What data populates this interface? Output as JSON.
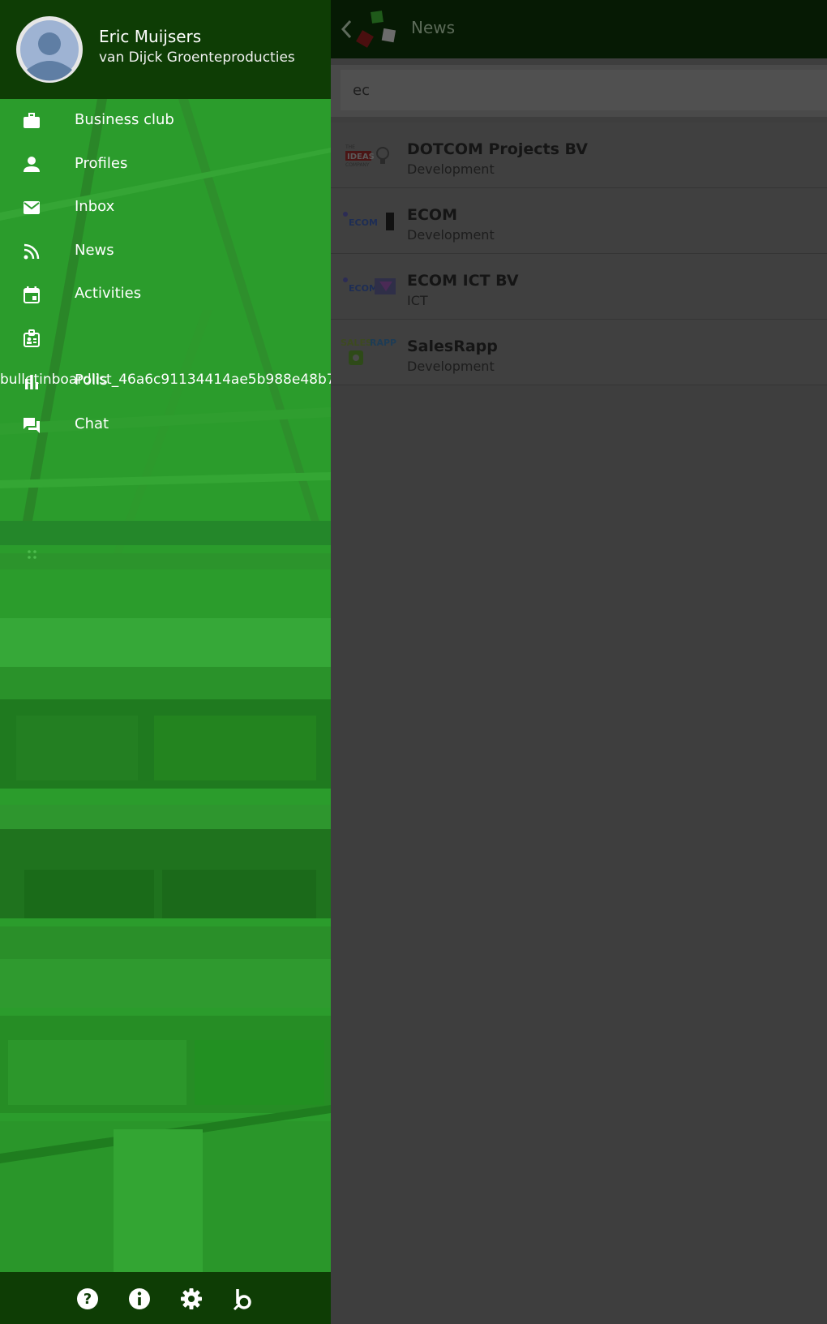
{
  "app": {
    "title": "News",
    "search": {
      "value": "ec"
    },
    "results": [
      {
        "title": "DOTCOM Projects BV",
        "category": "Development",
        "logo": "ideas-company-logo"
      },
      {
        "title": "ECOM",
        "category": "Development",
        "logo": "ecom-logo"
      },
      {
        "title": "ECOM ICT BV",
        "category": "ICT",
        "logo": "ecom-ict-logo"
      },
      {
        "title": "SalesRapp",
        "category": "Development",
        "logo": "salesrapp-logo"
      }
    ]
  },
  "drawer": {
    "user": {
      "name": "Eric Muijsers",
      "company": "van Dijck Groenteproducties"
    },
    "menu": [
      {
        "label": "Business club",
        "icon": "briefcase-icon"
      },
      {
        "label": "Profiles",
        "icon": "person-icon"
      },
      {
        "label": "Inbox",
        "icon": "mail-icon"
      },
      {
        "label": "News",
        "icon": "rss-icon"
      },
      {
        "label": "Activities",
        "icon": "calendar-icon"
      },
      {
        "label": "",
        "icon": "id-badge-icon"
      },
      {
        "label": "Polls",
        "icon": "poll-icon",
        "overflow_text": "bulletinboardlist_46a6c91134414ae5b988e48b7"
      },
      {
        "label": "Chat",
        "icon": "chat-icon"
      }
    ],
    "footer_icons": [
      "help-icon",
      "info-icon",
      "settings-icon",
      "brand-b-icon"
    ]
  },
  "colors": {
    "drawer_green": "#2b9c2c",
    "header_dark_green": "#0e3d05",
    "app_header": "#061a04",
    "overlay_gray": "#3e3e3e"
  }
}
